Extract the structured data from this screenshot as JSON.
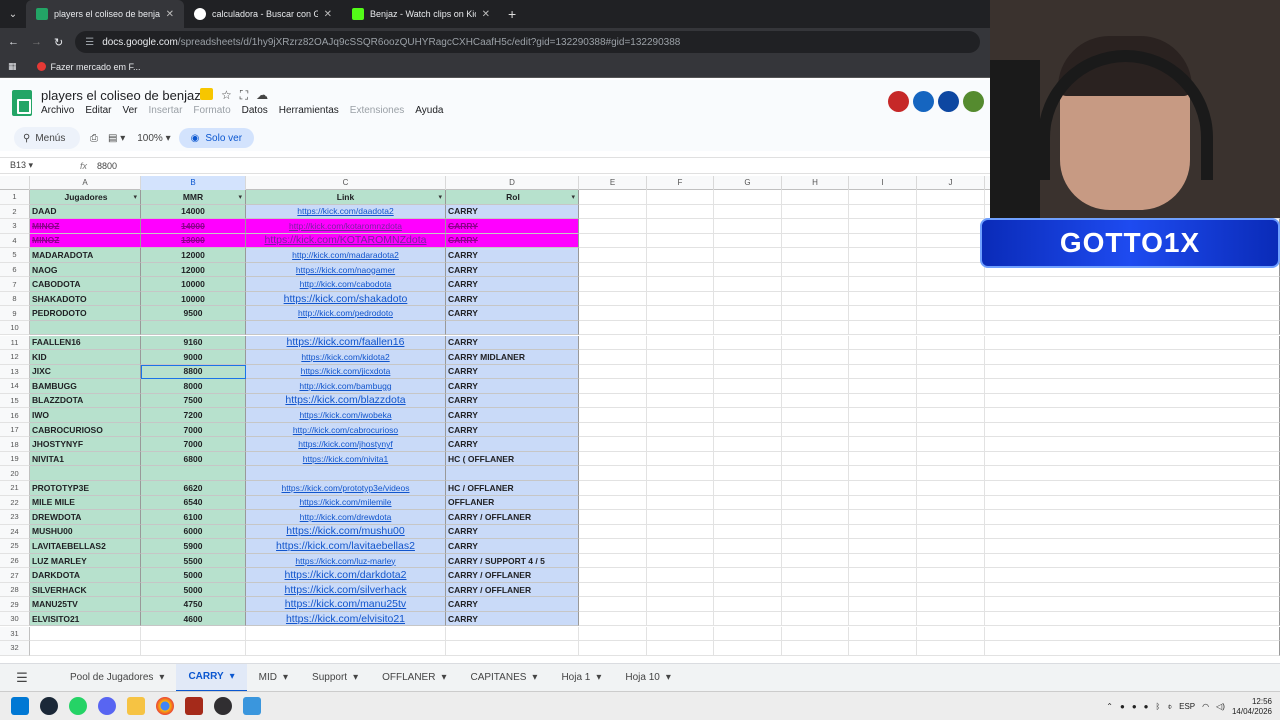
{
  "browser": {
    "tabs": [
      {
        "label": "players el coliseo de benjaz - H",
        "color": "#23a566",
        "active": true
      },
      {
        "label": "calculadora - Buscar con Googl",
        "color": "#ffffff",
        "active": false
      },
      {
        "label": "Benjaz - Watch clips on Kick",
        "color": "#53fc18",
        "active": false
      }
    ],
    "url_host": "docs.google.com",
    "url_path": "/spreadsheets/d/1hy9jXRzrz82OAJq9cSSQR6oozQUHYRagcCXHCaafH5c/edit?gid=132290388#gid=132290388",
    "bookmark": "Fazer mercado em F..."
  },
  "sheets": {
    "title": "players el coliseo de benjaz",
    "menu": [
      "Archivo",
      "Editar",
      "Ver",
      "Insertar",
      "Formato",
      "Datos",
      "Herramientas",
      "Extensiones",
      "Ayuda"
    ],
    "menu_disabled": [
      "Insertar",
      "Formato",
      "Extensiones"
    ],
    "search_label": "Menús",
    "zoom": "100%",
    "mode_label": "Solo ver",
    "cell_ref": "B13",
    "formula_value": "8800",
    "fx": "fx"
  },
  "columns": [
    "A",
    "B",
    "C",
    "D",
    "E",
    "F",
    "G",
    "H",
    "I",
    "J"
  ],
  "header_row": {
    "a": "Jugadores",
    "b": "MMR",
    "c": "Link",
    "d": "Rol"
  },
  "rows": [
    {
      "n": "2",
      "a": "DAAD",
      "b": "14000",
      "c": "https://kick.com/daadota2",
      "d": "CARRY",
      "style": "normal",
      "big": false
    },
    {
      "n": "3",
      "a": "MINOZ",
      "b": "14000",
      "c": "http://kick.com/kotaromnzdota",
      "d": "CARRY",
      "style": "magenta",
      "big": false
    },
    {
      "n": "4",
      "a": "MINOZ",
      "b": "13000",
      "c": "https://kick.com/KOTAROMNZdota",
      "d": "CARRY",
      "style": "magenta",
      "big": true
    },
    {
      "n": "5",
      "a": "MADARADOTA",
      "b": "12000",
      "c": "http://kick.com/madaradota2",
      "d": "CARRY",
      "style": "normal",
      "big": false
    },
    {
      "n": "6",
      "a": "NAOG",
      "b": "12000",
      "c": "https://kick.com/naogamer",
      "d": "CARRY",
      "style": "normal",
      "big": false
    },
    {
      "n": "7",
      "a": "CABODOTA",
      "b": "10000",
      "c": "http://kick.com/cabodota",
      "d": "CARRY",
      "style": "normal",
      "big": false
    },
    {
      "n": "8",
      "a": "SHAKADOTO",
      "b": "10000",
      "c": "https://kick.com/shakadoto",
      "d": "CARRY",
      "style": "normal",
      "big": true
    },
    {
      "n": "9",
      "a": "PEDRODOTO",
      "b": "9500",
      "c": "http://kick.com/pedrodoto",
      "d": "CARRY",
      "style": "normal",
      "big": false
    },
    {
      "n": "10",
      "a": "",
      "b": "",
      "c": "",
      "d": "",
      "style": "normal",
      "big": false
    },
    {
      "n": "11",
      "a": "FAALLEN16",
      "b": "9160",
      "c": "https://kick.com/faallen16",
      "d": "CARRY",
      "style": "normal",
      "big": true
    },
    {
      "n": "12",
      "a": "KID",
      "b": "9000",
      "c": "https://kick.com/kidota2",
      "d": "CARRY MIDLANER",
      "style": "normal",
      "big": false
    },
    {
      "n": "13",
      "a": "JIXC",
      "b": "8800",
      "c": "https://kick.com/jicxdota",
      "d": "CARRY",
      "style": "normal",
      "big": false,
      "selected": true
    },
    {
      "n": "14",
      "a": "BAMBUGG",
      "b": "8000",
      "c": "http://kick.com/bambugg",
      "d": "CARRY",
      "style": "normal",
      "big": false
    },
    {
      "n": "15",
      "a": "BLAZZDOTA",
      "b": "7500",
      "c": "https://kick.com/blazzdota",
      "d": "CARRY",
      "style": "normal",
      "big": true
    },
    {
      "n": "16",
      "a": "IWO",
      "b": "7200",
      "c": "https://kick.com/iwobeka",
      "d": "CARRY",
      "style": "normal",
      "big": false
    },
    {
      "n": "17",
      "a": "CABROCURIOSO",
      "b": "7000",
      "c": "http://kick.com/cabrocurioso",
      "d": "CARRY",
      "style": "normal",
      "big": false
    },
    {
      "n": "18",
      "a": "JHOSTYNYF",
      "b": "7000",
      "c": "https://kick.com/jhostynyf",
      "d": "CARRY",
      "style": "normal",
      "big": false
    },
    {
      "n": "19",
      "a": "NIVITA1",
      "b": "6800",
      "c": "https://kick.com/nivita1",
      "d": "HC ( OFFLANER",
      "style": "normal",
      "big": false
    },
    {
      "n": "20",
      "a": "",
      "b": "",
      "c": "",
      "d": "",
      "style": "normal",
      "big": false
    },
    {
      "n": "21",
      "a": "PROTOTYP3E",
      "b": "6620",
      "c": "https://kick.com/prototyp3e/videos",
      "d": "HC / OFFLANER",
      "style": "normal",
      "big": false
    },
    {
      "n": "22",
      "a": "MILE MILE",
      "b": "6540",
      "c": "https://kick.com/milemile",
      "d": "OFFLANER",
      "style": "normal",
      "big": false
    },
    {
      "n": "23",
      "a": "DREWDOTA",
      "b": "6100",
      "c": "http://kick.com/drewdota",
      "d": "CARRY / OFFLANER",
      "style": "normal",
      "big": false
    },
    {
      "n": "24",
      "a": "MUSHU00",
      "b": "6000",
      "c": "https://kick.com/mushu00",
      "d": "CARRY",
      "style": "normal",
      "big": true
    },
    {
      "n": "25",
      "a": "LAVITAEBELLAS2",
      "b": "5900",
      "c": "https://kick.com/lavitaebellas2",
      "d": "CARRY",
      "style": "normal",
      "big": true
    },
    {
      "n": "26",
      "a": "LUZ MARLEY",
      "b": "5500",
      "c": "https://kick.com/luz-marley",
      "d": "CARRY / SUPPORT 4 / 5",
      "style": "normal",
      "big": false
    },
    {
      "n": "27",
      "a": "DARKDOTA",
      "b": "5000",
      "c": "https://kick.com/darkdota2",
      "d": "CARRY / OFFLANER",
      "style": "normal",
      "big": true
    },
    {
      "n": "28",
      "a": "SILVERHACK",
      "b": "5000",
      "c": "https://kick.com/silverhack",
      "d": "CARRY / OFFLANER",
      "style": "normal",
      "big": true
    },
    {
      "n": "29",
      "a": "MANU25TV",
      "b": "4750",
      "c": "https://kick.com/manu25tv",
      "d": "CARRY",
      "style": "normal",
      "big": true
    },
    {
      "n": "30",
      "a": "ELVISITO21",
      "b": "4600",
      "c": "https://kick.com/elvisito21",
      "d": "CARRY",
      "style": "normal",
      "big": true
    },
    {
      "n": "31",
      "a": "",
      "b": "",
      "c": "",
      "d": "",
      "style": "empty",
      "big": false
    },
    {
      "n": "32",
      "a": "",
      "b": "",
      "c": "",
      "d": "",
      "style": "empty",
      "big": false
    }
  ],
  "sheet_tabs": [
    "Pool de Jugadores",
    "CARRY",
    "MID",
    "Support",
    "OFFLANER",
    "CAPITANES",
    "Hoja 1",
    "Hoja 10"
  ],
  "active_sheet": "CARRY",
  "webcam_overlay": "GOTTO1X",
  "taskbar": {
    "lang": "ESP",
    "time": "12:56",
    "date": "14/04/2026"
  }
}
